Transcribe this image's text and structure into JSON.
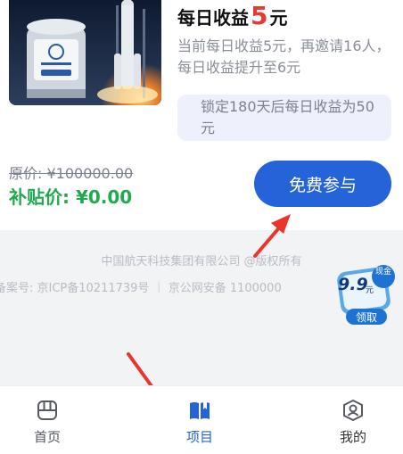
{
  "product": {
    "title_prefix": "每日收益",
    "title_amount": "5",
    "title_suffix": "元",
    "description": "当前每日收益5元，再邀请16人，每日收益提升至6元",
    "lock_note": "锁定180天后每日收益为50元",
    "original_price": "原价: ¥100000.00",
    "subsidy_price": "补贴价: ¥0.00",
    "join_label": "免费参与"
  },
  "footer": {
    "company": "中国航天科技集团有限公司 @版权所有",
    "icp": "备案号: 京ICP备10211739号 ｜ 京公网安备 1100000"
  },
  "promo": {
    "amount": "9.9",
    "unit": "元",
    "badge": "现金",
    "claim_label": "领取"
  },
  "nav": {
    "items": [
      {
        "label": "首页",
        "icon": "home-icon",
        "active": false
      },
      {
        "label": "项目",
        "icon": "book-icon",
        "active": true
      },
      {
        "label": "我的",
        "icon": "profile-icon",
        "active": false
      }
    ]
  },
  "colors": {
    "accent": "#2563d9",
    "price_red": "#e53935",
    "subsidy_green": "#1faa4f",
    "annotation_red": "#e8362c",
    "nav_inactive": "#555a63"
  }
}
